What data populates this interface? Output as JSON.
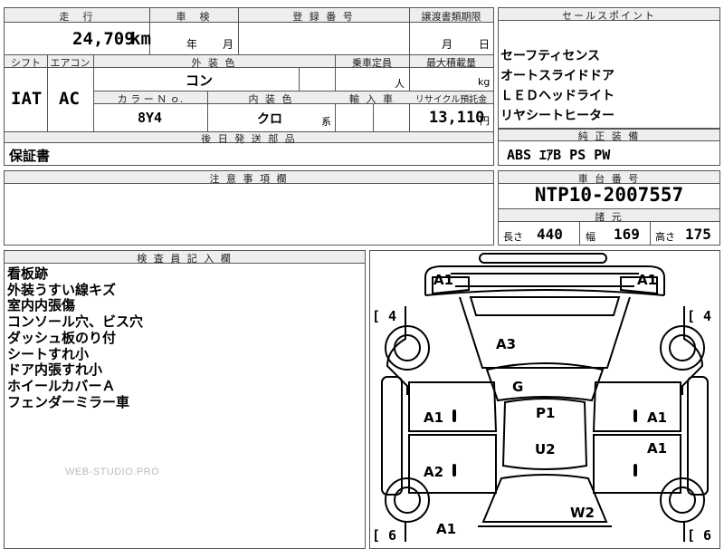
{
  "header_fields": {
    "mileage_label": "走　行",
    "shaken_label": "車　検",
    "registration_label": "登 録 番 号",
    "transfer_deadline_label": "譲渡書類期限",
    "mileage_value": "24,709",
    "mileage_unit": "km",
    "shaken_year_unit": "年",
    "shaken_month_unit": "月",
    "transfer_month_unit": "月",
    "transfer_day_unit": "日"
  },
  "row2": {
    "shift_label": "シフト",
    "aircon_label": "エアコン",
    "exterior_color_label": "外 装 色",
    "capacity_label": "乗車定員",
    "max_load_label": "最大積載量",
    "shift_value": "IAT",
    "aircon_value": "AC",
    "exterior_color_value": "コン",
    "capacity_unit": "人",
    "load_unit": "kg",
    "color_no_label": "カ ラ ー Ｎ ｏ.",
    "interior_color_label": "内 装 色",
    "import_label": "輸 入 車",
    "recycle_label": "リサイクル預託金",
    "color_no_value": "8Y4",
    "interior_color_value": "クロ",
    "interior_suffix": "系",
    "recycle_value": "13,110",
    "recycle_unit": "円"
  },
  "later_parts": {
    "label": "後 日 発 送 部 品",
    "value": "保証書"
  },
  "notes": {
    "label": "注 意 事 項 欄"
  },
  "sales_points": {
    "label": "セールスポイント",
    "items": [
      "セーフティセンス",
      "オートスライドドア",
      "ＬＥＤヘッドライト",
      "リヤシートヒーター"
    ]
  },
  "equipment": {
    "label": "純 正 装 備",
    "value": "ABS ｴｱB PS PW"
  },
  "chassis": {
    "label": "車 台 番 号",
    "value": "NTP10-2007557"
  },
  "specs": {
    "label": "諸 元",
    "length_label": "長さ",
    "length_value": "440",
    "width_label": "幅",
    "width_value": "169",
    "height_label": "高さ",
    "height_value": "175"
  },
  "inspector": {
    "label": "検 査 員 記 入 欄",
    "lines": [
      "看板跡",
      "外装うすい線キズ",
      "室内内張傷",
      "コンソール穴、ビス穴",
      "ダッシュ板のり付",
      "シートすれ小",
      "ドア内張すれ小",
      "ホイールカバーＡ",
      "フェンダーミラー車"
    ]
  },
  "watermark": "WEB-STUDIO.PRO",
  "diagram": {
    "labels": {
      "front_left": "A1",
      "front_right": "A1",
      "bonnet": "A3",
      "glass": "G",
      "left_front_door": "A1",
      "roof": "P1",
      "right_front_door": "A1",
      "roof_rear": "U2",
      "right_rear_door": "A1",
      "left_rear_door": "A2",
      "rear_window": "W2",
      "rear_left": "A1"
    },
    "tyre_left_front": "[ 4",
    "tyre_right_front": "[ 4",
    "tyre_left_rear": "[ 6",
    "tyre_right_rear": "[ 6"
  }
}
